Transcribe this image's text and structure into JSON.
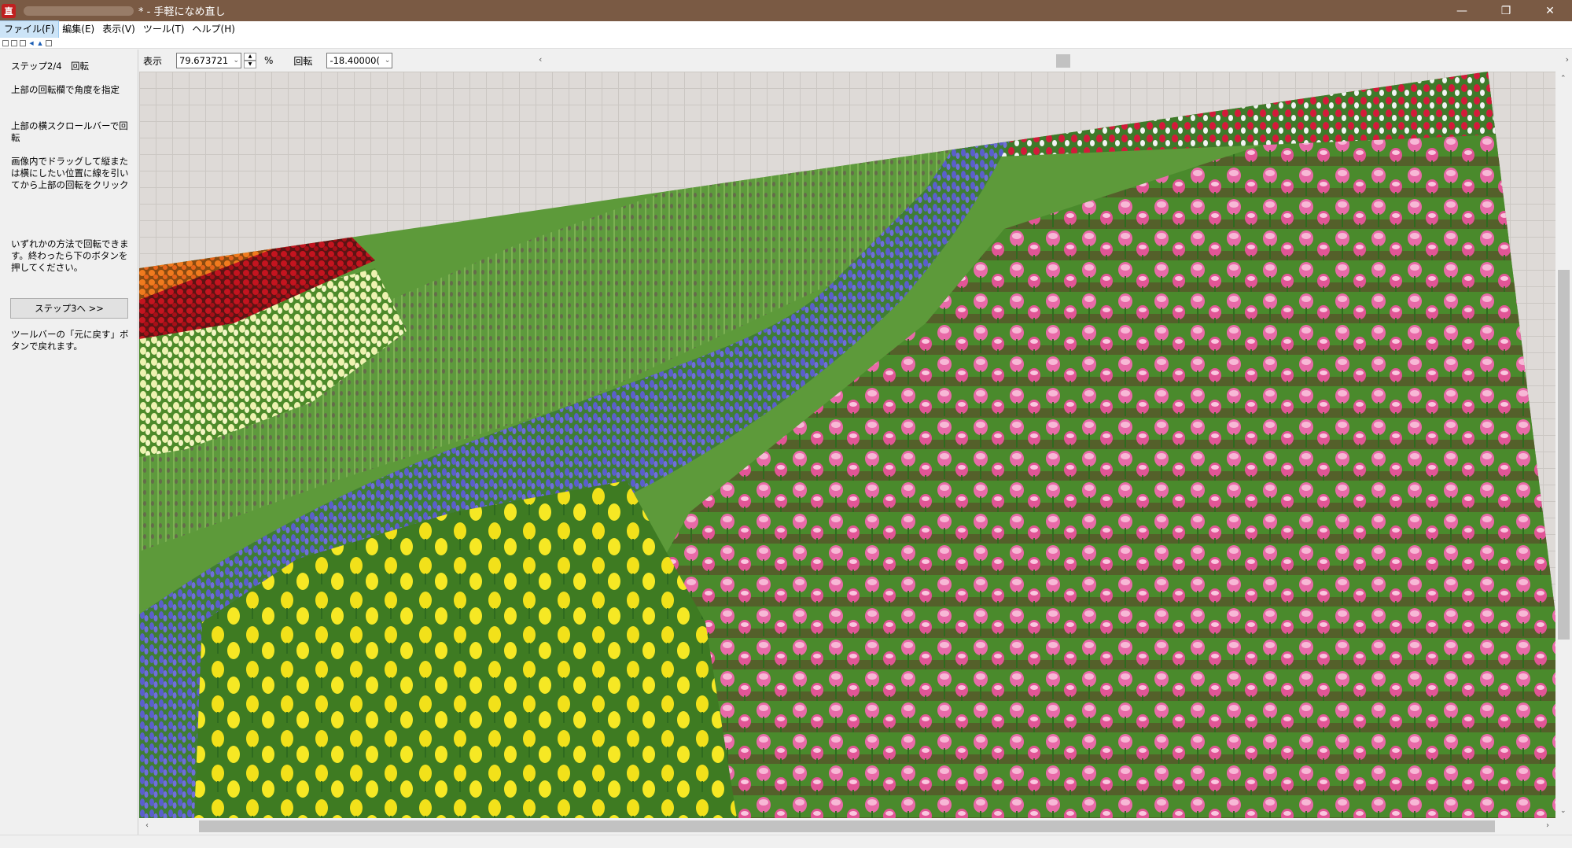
{
  "window": {
    "title": "* - 手軽になめ直し",
    "app_icon_label": "直",
    "controls": [
      "minimize",
      "restore",
      "close"
    ]
  },
  "menu": [
    {
      "label": "ファイル(F)",
      "active": true
    },
    {
      "label": "編集(E)",
      "active": false
    },
    {
      "label": "表示(V)",
      "active": false
    },
    {
      "label": "ツール(T)",
      "active": false
    },
    {
      "label": "ヘルプ(H)",
      "active": false
    }
  ],
  "left_panel": {
    "step_title": "ステップ2/4　回転",
    "instruction_1": "上部の回転欄で角度を指定",
    "instruction_2": "上部の横スクロールバーで回転",
    "instruction_3": "画像内でドラッグして縦または横にしたい位置に線を引いてから上部の回転をクリック",
    "instruction_4": "いずれかの方法で回転できます。終わったら下のボタンを押してください。",
    "next_button": "ステップ3へ >>",
    "undo_note": "ツールバーの「元に戻す」ボタンで戻れます。"
  },
  "controls": {
    "zoom_label": "表示",
    "zoom_value": "79.673721",
    "zoom_unit": "%",
    "rotate_label": "回転",
    "rotate_value": "-18.40000("
  },
  "canvas": {
    "rotation_deg": -18.4,
    "image_subject": "tulip field"
  }
}
